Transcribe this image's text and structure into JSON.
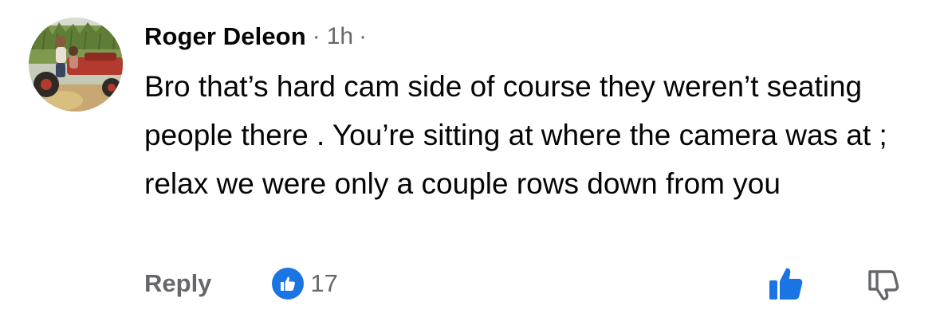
{
  "comment": {
    "author": "Roger Deleon",
    "separator": "·",
    "timestamp": "1h",
    "separator_after": "·",
    "text": "Bro that’s hard cam side of course they weren’t seating people there . You’re sitting at where the camera was at ; relax we were only a couple rows down from you",
    "avatar_icon": "profile-photo-icon"
  },
  "actions": {
    "reply_label": "Reply",
    "reaction_count": "17",
    "reaction_icon": "thumbs-up-icon",
    "like_icon": "thumbs-up-icon",
    "dislike_icon": "thumbs-down-icon"
  },
  "colors": {
    "text": "#050505",
    "secondary": "#65676b",
    "accent": "#1b74e4"
  }
}
